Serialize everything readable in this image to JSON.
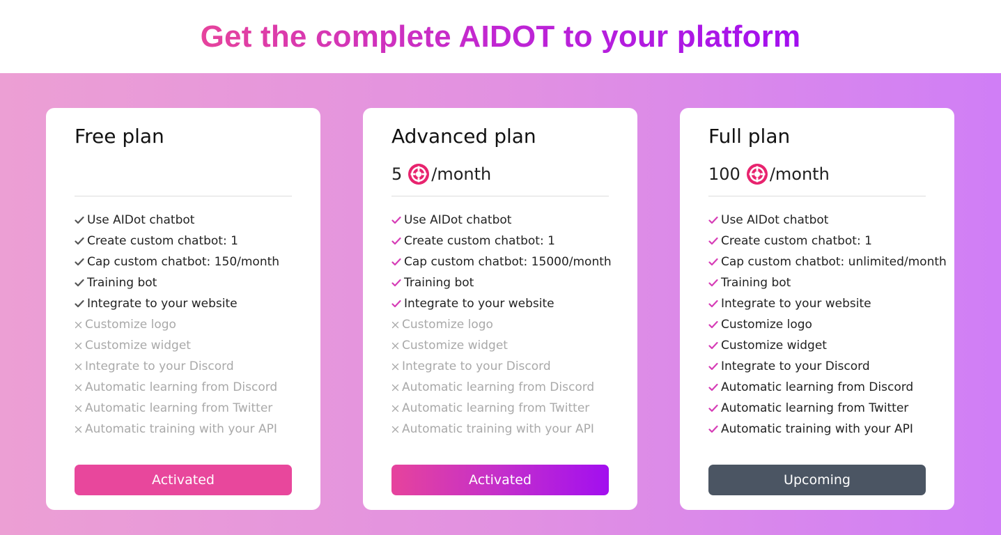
{
  "header": {
    "title": "Get the complete AIDOT to your platform"
  },
  "colors": {
    "gradient_start": "#e6439c",
    "gradient_end": "#a20fef",
    "check_pink": "#d63cb6",
    "check_gray": "#555555",
    "disabled_text": "#a9a9a9",
    "coin": "#e8236e",
    "upcoming_button": "#4b5563"
  },
  "plans": [
    {
      "name": "Free plan",
      "price": "",
      "price_suffix": "",
      "button": "Activated",
      "features": [
        {
          "label": "Use AIDot chatbot",
          "included": true
        },
        {
          "label": "Create custom chatbot: 1",
          "included": true
        },
        {
          "label": "Cap custom chatbot: 150/month",
          "included": true
        },
        {
          "label": "Training bot",
          "included": true
        },
        {
          "label": "Integrate to your website",
          "included": true
        },
        {
          "label": "Customize logo",
          "included": false
        },
        {
          "label": "Customize widget",
          "included": false
        },
        {
          "label": "Integrate to your Discord",
          "included": false
        },
        {
          "label": "Automatic learning from Discord",
          "included": false
        },
        {
          "label": "Automatic learning from Twitter",
          "included": false
        },
        {
          "label": "Automatic training with your API",
          "included": false
        }
      ]
    },
    {
      "name": "Advanced plan",
      "price": "5",
      "price_suffix": "/month",
      "button": "Activated",
      "features": [
        {
          "label": "Use AIDot chatbot",
          "included": true
        },
        {
          "label": "Create custom chatbot: 1",
          "included": true
        },
        {
          "label": "Cap custom chatbot: 15000/month",
          "included": true
        },
        {
          "label": "Training bot",
          "included": true
        },
        {
          "label": "Integrate to your website",
          "included": true
        },
        {
          "label": "Customize logo",
          "included": false
        },
        {
          "label": "Customize widget",
          "included": false
        },
        {
          "label": "Integrate to your Discord",
          "included": false
        },
        {
          "label": "Automatic learning from Discord",
          "included": false
        },
        {
          "label": "Automatic learning from Twitter",
          "included": false
        },
        {
          "label": "Automatic training with your API",
          "included": false
        }
      ]
    },
    {
      "name": "Full plan",
      "price": "100",
      "price_suffix": "/month",
      "button": "Upcoming",
      "features": [
        {
          "label": "Use AIDot chatbot",
          "included": true
        },
        {
          "label": "Create custom chatbot: 1",
          "included": true
        },
        {
          "label": "Cap custom chatbot: unlimited/month",
          "included": true
        },
        {
          "label": "Training bot",
          "included": true
        },
        {
          "label": "Integrate to your website",
          "included": true
        },
        {
          "label": "Customize logo",
          "included": true
        },
        {
          "label": "Customize widget",
          "included": true
        },
        {
          "label": "Integrate to your Discord",
          "included": true
        },
        {
          "label": "Automatic learning from Discord",
          "included": true
        },
        {
          "label": "Automatic learning from Twitter",
          "included": true
        },
        {
          "label": "Automatic training with your API",
          "included": true
        }
      ]
    }
  ]
}
